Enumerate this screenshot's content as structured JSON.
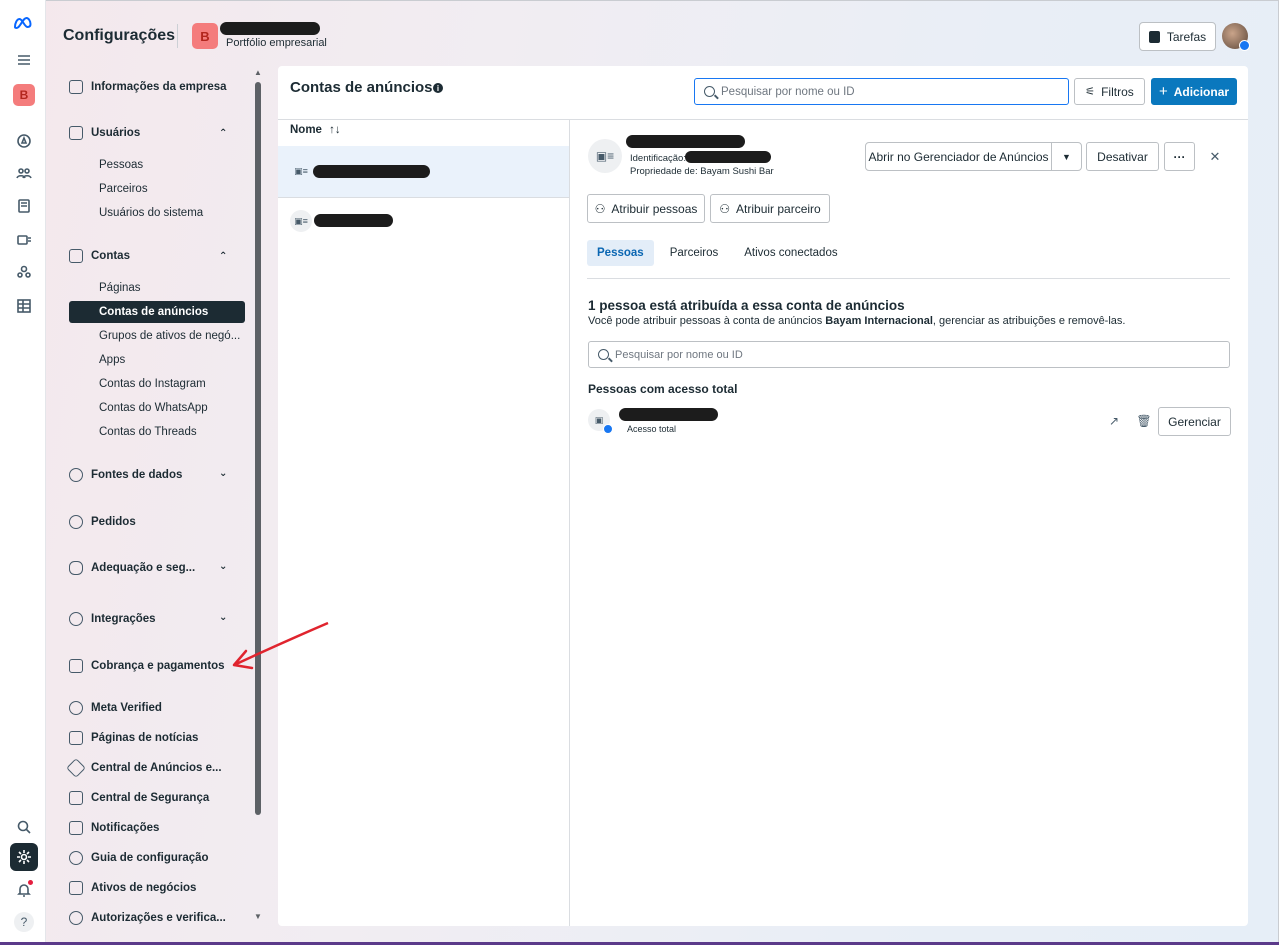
{
  "header": {
    "title": "Configurações",
    "avatar_letter": "B",
    "portfolio_label": "Portfólio empresarial",
    "tasks_label": "Tarefas"
  },
  "rail": {
    "avatar_letter": "B",
    "help_label": "?"
  },
  "sidebar": {
    "company_info": "Informações da empresa",
    "users": {
      "label": "Usuários",
      "items": [
        "Pessoas",
        "Parceiros",
        "Usuários do sistema"
      ]
    },
    "accounts": {
      "label": "Contas",
      "items": [
        "Páginas",
        "Contas de anúncios",
        "Grupos de ativos de negó...",
        "Apps",
        "Contas do Instagram",
        "Contas do WhatsApp",
        "Contas do Threads"
      ]
    },
    "sections": [
      "Fontes de dados",
      "Pedidos",
      "Adequação e seg...",
      "Integrações",
      "Cobrança e pagamentos",
      "Meta Verified",
      "Páginas de notícias",
      "Central de Anúncios e...",
      "Central de Segurança",
      "Notificações",
      "Guia de configuração",
      "Ativos de negócios",
      "Autorizações e verifica..."
    ]
  },
  "main": {
    "title": "Contas de anúncios",
    "info_icon": "i",
    "search_placeholder": "Pesquisar por nome ou ID",
    "filters_label": "Filtros",
    "add_label": "Adicionar",
    "column_name": "Nome",
    "sort_icon": "↑↓"
  },
  "detail": {
    "id_label": "Identificação:",
    "owner_label": "Propriedade de: Bayam Sushi Bar",
    "open_manager_label": "Abrir no Gerenciador de Anúncios",
    "deactivate_label": "Desativar",
    "more_label": "···",
    "close_label": "✕",
    "assign_people_label": "Atribuir pessoas",
    "assign_partner_label": "Atribuir parceiro",
    "tabs": [
      "Pessoas",
      "Parceiros",
      "Ativos conectados"
    ],
    "heading": "1 pessoa está atribuída a essa conta de anúncios",
    "description_pre": "Você pode atribuir pessoas à conta de anúncios ",
    "description_bold": "Bayam Internacional",
    "description_post": ", gerenciar as atribuições e removê-las.",
    "people_search_placeholder": "Pesquisar por nome ou ID",
    "full_access_heading": "Pessoas com acesso total",
    "person_access": "Acesso total",
    "manage_label": "Gerenciar"
  },
  "colors": {
    "primary": "#0a78be",
    "active_nav": "#1c2b33",
    "annotation_arrow": "#e0242e"
  }
}
